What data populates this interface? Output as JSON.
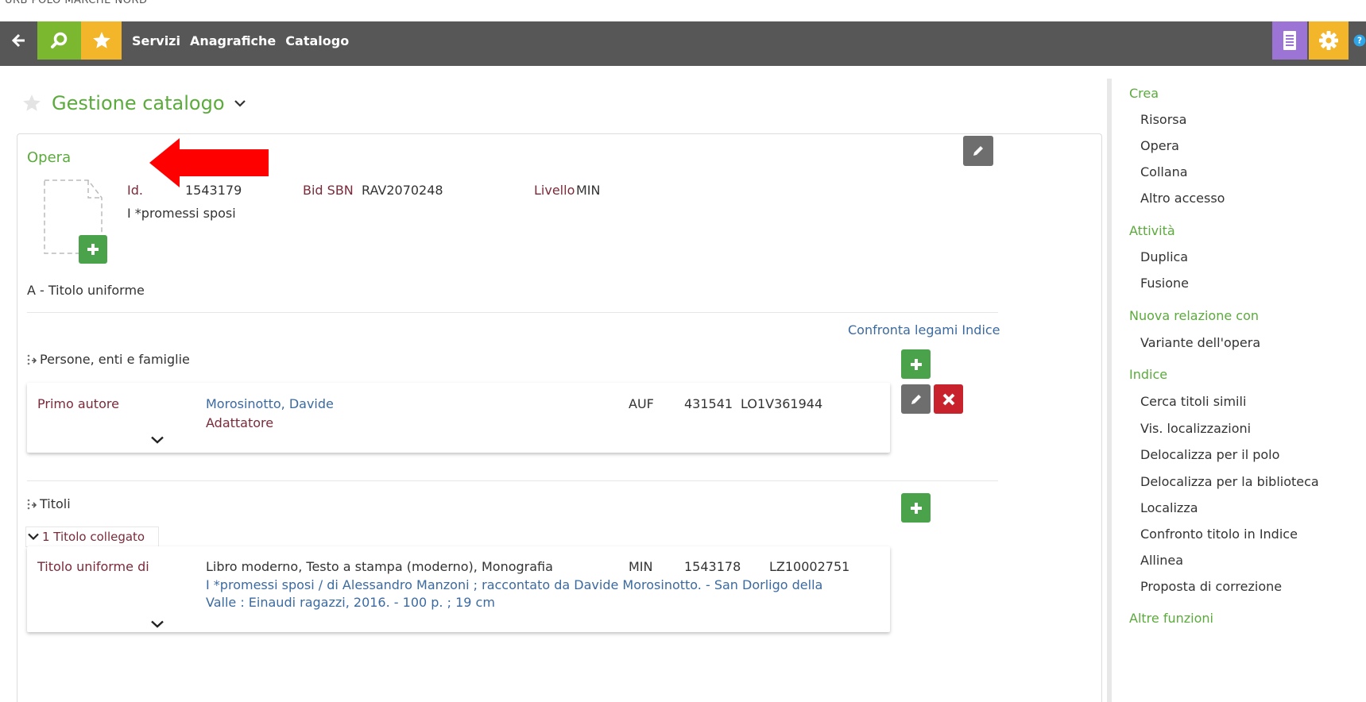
{
  "window": {
    "topline": "URB POLO MARCHE NORD"
  },
  "topbar": {
    "nav": [
      "Servizi",
      "Anagrafiche",
      "Catalogo"
    ]
  },
  "page": {
    "title": "Gestione catalogo"
  },
  "opera": {
    "section_title": "Opera",
    "id_label": "Id.",
    "id_value": "1543179",
    "bid_label": "Bid SBN",
    "bid_value": "RAV2070248",
    "livello_label": "Livello",
    "livello_value": "MIN",
    "title": "I *promessi sposi",
    "type": "A - Titolo uniforme",
    "compare_link": "Confronta legami Indice"
  },
  "persone": {
    "header": "Persone, enti e famiglie",
    "row": {
      "role": "Primo autore",
      "name": "Morosinotto, Davide",
      "subrole": "Adattatore",
      "code": "AUF",
      "id": "431541",
      "sbn": "LO1V361944"
    }
  },
  "titoli": {
    "header": "Titoli",
    "collapse_label": "1 Titolo collegato",
    "row": {
      "role": "Titolo uniforme di",
      "desc": "Libro moderno, Testo a stampa (moderno), Monografia",
      "level": "MIN",
      "id": "1543178",
      "sbn": "LZ10002751",
      "line1": "I *promessi sposi / di Alessandro Manzoni ; raccontato da Davide Morosinotto. - San Dorligo della",
      "line2": "Valle : Einaudi ragazzi, 2016. - 100 p. ; 19 cm"
    }
  },
  "sidebar": {
    "crea": {
      "title": "Crea",
      "items": [
        "Risorsa",
        "Opera",
        "Collana",
        "Altro accesso"
      ]
    },
    "attivita": {
      "title": "Attività",
      "items": [
        "Duplica",
        "Fusione"
      ]
    },
    "nuova": {
      "title": "Nuova relazione con",
      "items": [
        "Variante dell'opera"
      ]
    },
    "indice": {
      "title": "Indice",
      "items": [
        "Cerca titoli simili",
        "Vis. localizzazioni",
        "Delocalizza per il polo",
        "Delocalizza per la biblioteca",
        "Localizza",
        "Confronto titolo in Indice",
        "Allinea",
        "Proposta di correzione"
      ]
    },
    "altre": {
      "title": "Altre funzioni"
    }
  },
  "colors": {
    "topbar": "#575757",
    "search": "#7cb82f",
    "star": "#f3b52a",
    "doc": "#9b74d6",
    "green_text": "#5bab3c",
    "label": "#7b2a3a",
    "link": "#3b6aa0"
  }
}
